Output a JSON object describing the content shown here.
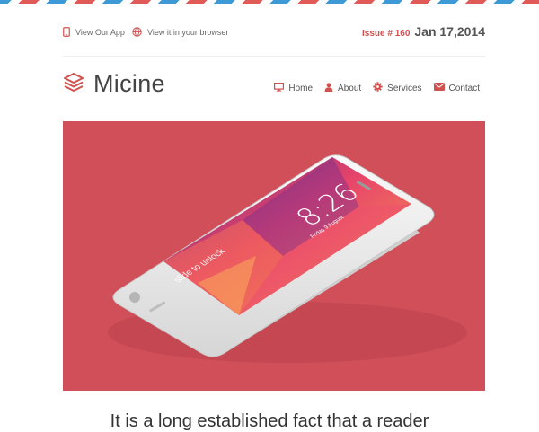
{
  "top_links": {
    "app": "View Our App",
    "browser": "View it in your browser"
  },
  "issue": {
    "number": "Issue # 160",
    "date": "Jan 17,2014"
  },
  "brand": {
    "name": "Micine"
  },
  "nav": [
    {
      "label": "Home",
      "icon": "monitor-icon"
    },
    {
      "label": "About",
      "icon": "user-icon"
    },
    {
      "label": "Services",
      "icon": "gear-icon"
    },
    {
      "label": "Contact",
      "icon": "envelope-icon"
    }
  ],
  "hero": {
    "time": "8:26",
    "date": "Friday 9 August",
    "unlock": "slide to unlock"
  },
  "lead_text": "It is a long established fact that a reader",
  "colors": {
    "accent": "#d04f58",
    "airmail_red": "#e05a58",
    "airmail_blue": "#3d9ad6"
  }
}
